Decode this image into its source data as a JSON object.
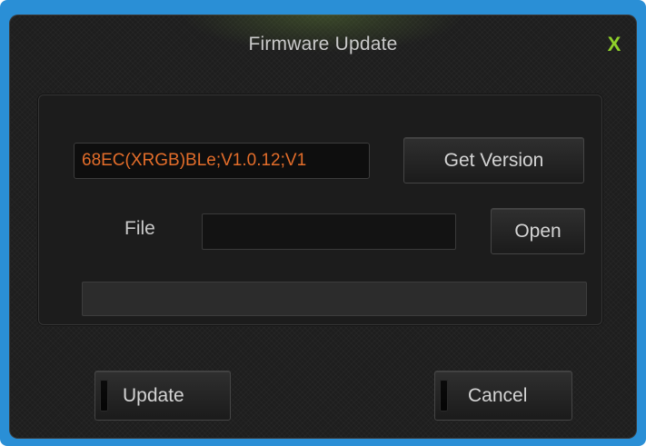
{
  "window": {
    "title": "Firmware Update",
    "close_label": "X"
  },
  "version": {
    "value": "68EC(XRGB)BLe;V1.0.12;V1",
    "get_version_label": "Get Version"
  },
  "file": {
    "label": "File",
    "value": "",
    "placeholder": "",
    "open_label": "Open"
  },
  "progress": {
    "fraction": 0
  },
  "actions": {
    "update_label": "Update",
    "cancel_label": "Cancel"
  },
  "colors": {
    "accent": "#8fd12a",
    "version_text": "#e36d2a",
    "frame": "#2a8fd6",
    "background": "#1e1e1e"
  },
  "icons": {
    "close": "close-icon"
  }
}
